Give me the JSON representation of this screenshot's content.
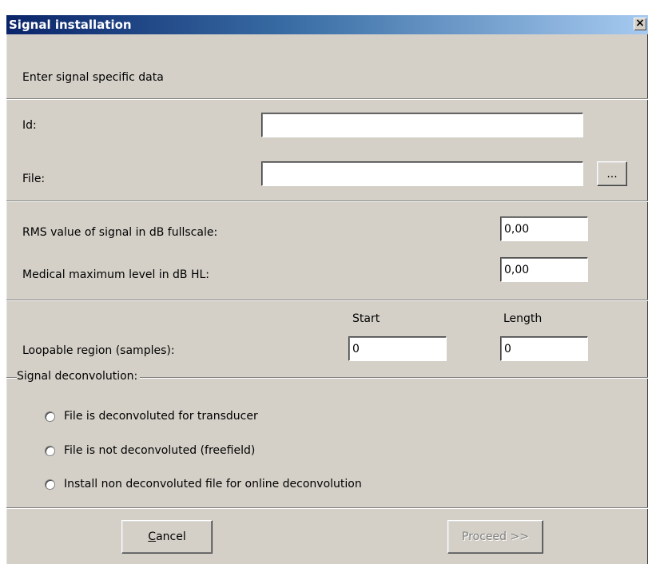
{
  "window": {
    "title": "Signal installation",
    "close_glyph": "×"
  },
  "intro": "Enter signal specific data",
  "fields": {
    "id_label": "Id:",
    "id_value": "",
    "file_label": "File:",
    "file_value": "",
    "browse_label": "..."
  },
  "levels": {
    "rms_label": "RMS value of signal in dB fullscale:",
    "rms_value": "0,00",
    "medical_label": "Medical maximum level in dB HL:",
    "medical_value": "0,00"
  },
  "loop": {
    "start_header": "Start",
    "length_header": "Length",
    "label": "Loopable region (samples):",
    "start_value": "0",
    "length_value": "0"
  },
  "deconvolution": {
    "title": "Signal deconvolution:",
    "options": [
      {
        "label": "File is deconvoluted for transducer",
        "selected": false
      },
      {
        "label": "File is not deconvoluted (freefield)",
        "selected": false
      },
      {
        "label": "Install non deconvoluted file for online deconvolution",
        "selected": false
      }
    ]
  },
  "buttons": {
    "cancel": "Cancel",
    "proceed": "Proceed >>",
    "proceed_enabled": false
  }
}
